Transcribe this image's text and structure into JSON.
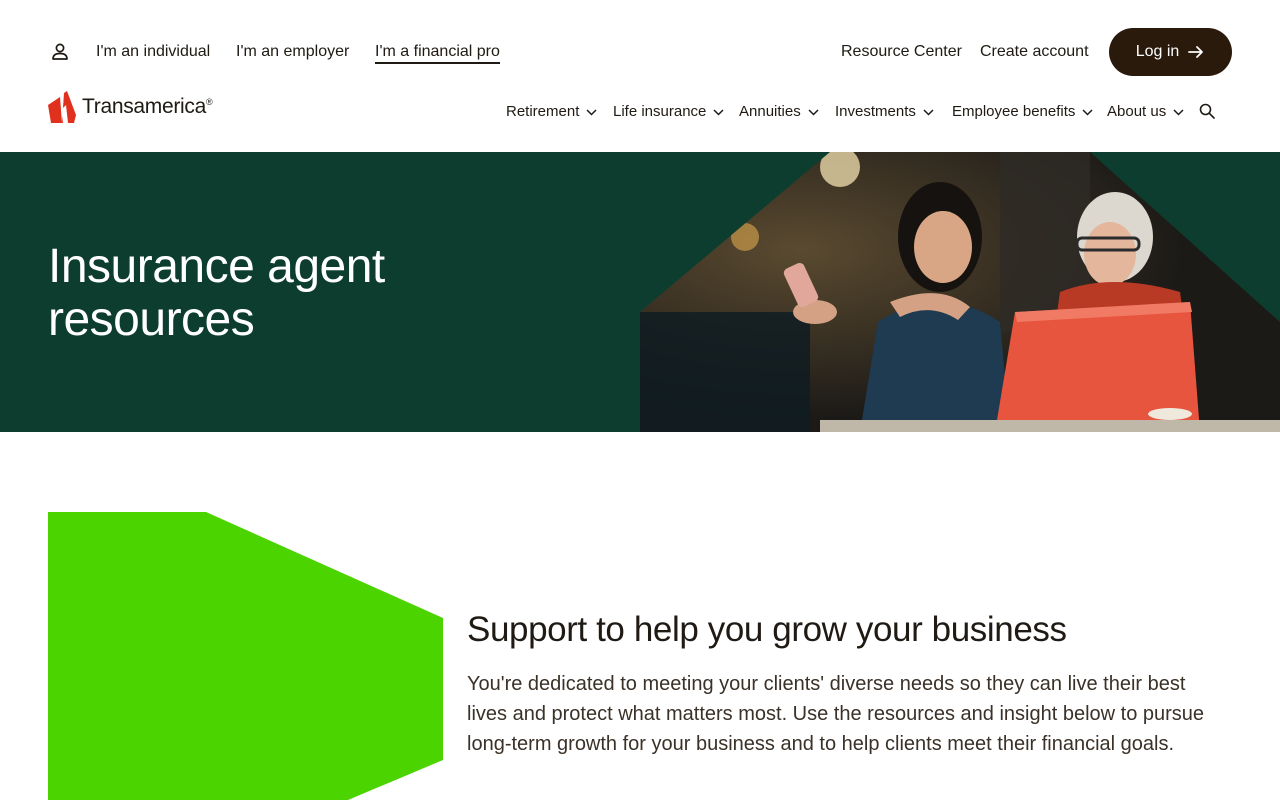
{
  "utility_nav": {
    "audiences": [
      {
        "label": "I'm an individual",
        "active": false
      },
      {
        "label": "I'm an employer",
        "active": false
      },
      {
        "label": "I'm a financial pro",
        "active": true
      }
    ],
    "resource_center": "Resource Center",
    "create_account": "Create account",
    "login_label": "Log in"
  },
  "brand": {
    "name": "Transamerica",
    "registered_mark": "®",
    "logo_color": "#e0301e"
  },
  "main_nav": {
    "items": [
      {
        "label": "Retirement"
      },
      {
        "label": "Life insurance"
      },
      {
        "label": "Annuities"
      },
      {
        "label": "Investments"
      },
      {
        "label": "Employee benefits"
      },
      {
        "label": "About us"
      }
    ]
  },
  "hero": {
    "title_line1": "Insurance agent",
    "title_line2": "resources",
    "background_color": "#0c3d2e",
    "image_icon": "photo-two-women-phone-laptop"
  },
  "support": {
    "heading": "Support to help you grow your business",
    "body": "You're dedicated to meeting your clients' diverse needs so they can live their best lives and protect what matters most. Use the resources and insight below to pursue long-term growth for your business and to help clients meet their financial goals.",
    "accent_color": "#4cd400"
  },
  "colors": {
    "text": "#1f1a14",
    "button_dark": "#2a1a0c"
  }
}
